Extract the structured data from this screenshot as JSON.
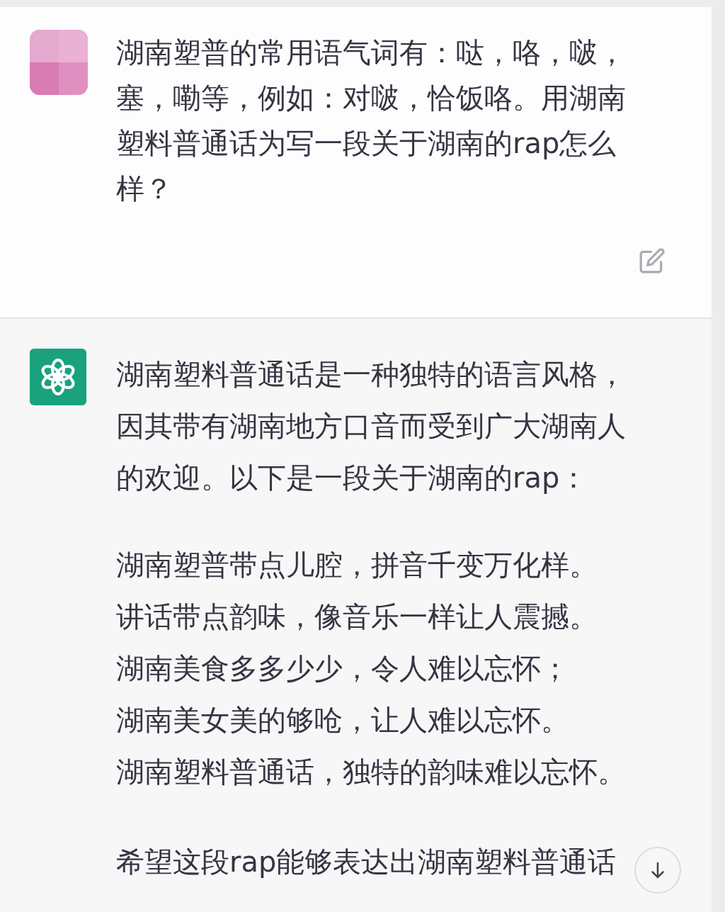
{
  "messages": [
    {
      "kind": "user",
      "paragraphs": [
        "湖南塑普的常用语气词有：哒，咯，啵，塞，嘞等，例如：对啵，恰饭咯。用湖南塑料普通话为写一段关于湖南的rap怎么样？"
      ]
    },
    {
      "kind": "assistant",
      "paragraphs": [
        "湖南塑料普通话是一种独特的语言风格，因其带有湖南地方口音而受到广大湖南人的欢迎。以下是一段关于湖南的rap："
      ],
      "verses": [
        "湖南塑普带点儿腔，拼音千变万化样。",
        "讲话带点韵味，像音乐一样让人震撼。",
        "湖南美食多多少少，令人难以忘怀；",
        "湖南美女美的够呛，让人难以忘怀。",
        "湖南塑料普通话，独特的韵味难以忘怀。"
      ],
      "closing": "希望这段rap能够表达出湖南塑料普通话"
    }
  ]
}
